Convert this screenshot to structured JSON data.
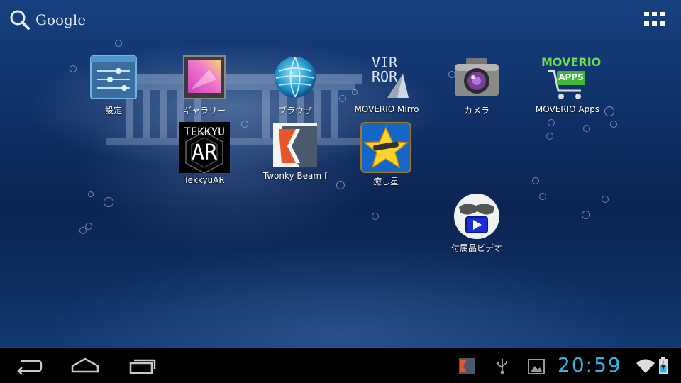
{
  "search": {
    "label": "Google"
  },
  "apps": [
    {
      "id": "settings",
      "label": "設定",
      "icon": "settings-sliders-icon"
    },
    {
      "id": "gallery",
      "label": "ギャラリー",
      "icon": "gallery-icon"
    },
    {
      "id": "browser",
      "label": "ブラウザ",
      "icon": "globe-icon"
    },
    {
      "id": "moverio-mirror",
      "label": "MOVERIO Mirro",
      "icon": "moverio-mirror-icon",
      "icon_text": [
        "VIR",
        "ROR"
      ]
    },
    {
      "id": "camera",
      "label": "カメラ",
      "icon": "camera-icon"
    },
    {
      "id": "moverio-apps",
      "label": "MOVERIO Apps",
      "icon": "shopping-cart-icon",
      "icon_text": [
        "MOVERIO",
        "APPS"
      ]
    },
    {
      "id": "tekkyuar",
      "label": "TekkyuAR",
      "icon": "tekkyuar-icon",
      "icon_text": [
        "TEKKYU",
        "AR"
      ]
    },
    {
      "id": "twonky",
      "label": "Twonky Beam f",
      "icon": "twonky-icon"
    },
    {
      "id": "iyashiboshi",
      "label": "癒し星",
      "icon": "star-icon"
    },
    {
      "id": "video",
      "label": "付属品ビデオ",
      "icon": "glasses-play-icon"
    }
  ],
  "navbar": {
    "buttons": [
      "back-icon",
      "home-icon",
      "recent-apps-icon"
    ],
    "status_icons": [
      "twonky-notification-icon",
      "usb-icon",
      "image-notification-icon",
      "wifi-icon",
      "battery-charging-icon"
    ],
    "clock": "20:59"
  },
  "colors": {
    "clock": "#33b5e5",
    "navbar": "#000000"
  }
}
